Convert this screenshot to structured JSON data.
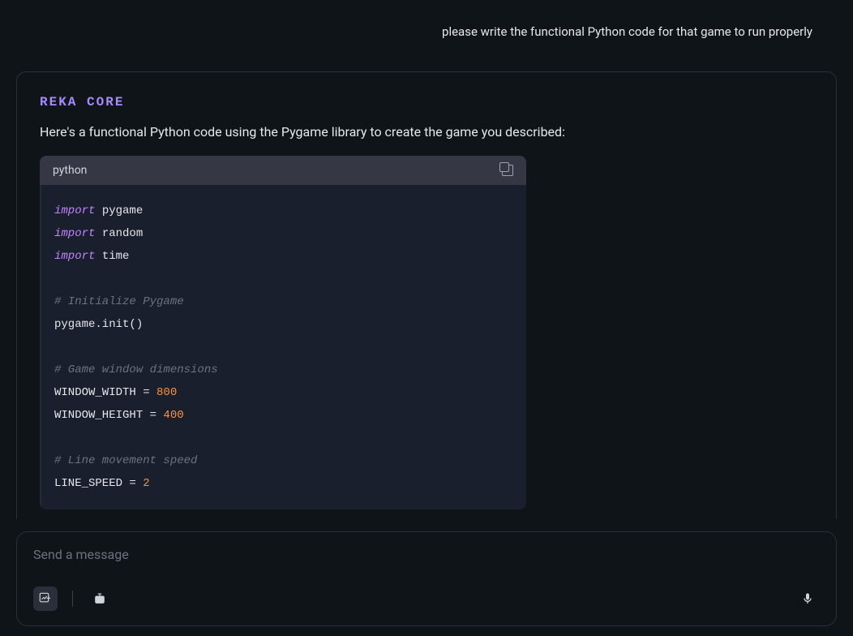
{
  "user_message": "please write the functional Python code for that game to run properly",
  "assistant": {
    "model_name": "REKA CORE",
    "intro_text": "Here's a functional Python code using the Pygame library to create the game you described:",
    "code": {
      "language": "python",
      "lines": [
        {
          "type": "import",
          "kw": "import",
          "rest": " pygame"
        },
        {
          "type": "import",
          "kw": "import",
          "rest": " random"
        },
        {
          "type": "import",
          "kw": "import",
          "rest": " time"
        },
        {
          "type": "blank"
        },
        {
          "type": "comment",
          "text": "# Initialize Pygame"
        },
        {
          "type": "plain",
          "text": "pygame.init()"
        },
        {
          "type": "blank"
        },
        {
          "type": "comment",
          "text": "# Game window dimensions"
        },
        {
          "type": "assign",
          "lhs": "WINDOW_WIDTH = ",
          "num": "800"
        },
        {
          "type": "assign",
          "lhs": "WINDOW_HEIGHT = ",
          "num": "400"
        },
        {
          "type": "blank"
        },
        {
          "type": "comment",
          "text": "# Line movement speed"
        },
        {
          "type": "assign",
          "lhs": "LINE_SPEED = ",
          "num": "2"
        }
      ]
    }
  },
  "input": {
    "placeholder": "Send a message"
  }
}
